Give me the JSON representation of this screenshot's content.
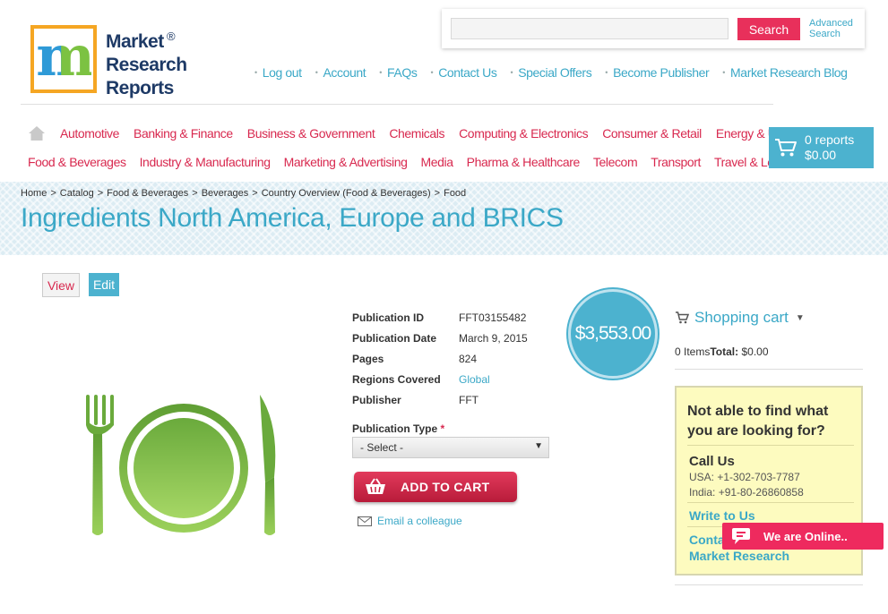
{
  "brand": {
    "logo_letter": "m",
    "name_lines": [
      "Market",
      "Research",
      "Reports"
    ],
    "registered": "®"
  },
  "search": {
    "placeholder": "",
    "button_label": "Search",
    "advanced_line1": "Advanced",
    "advanced_line2": "Search"
  },
  "top_nav": [
    "Log out",
    "Account",
    "FAQs",
    "Contact Us",
    "Special Offers",
    "Become Publisher",
    "Market Research Blog"
  ],
  "categories": {
    "row1": [
      "Automotive",
      "Banking & Finance",
      "Business & Government",
      "Chemicals",
      "Computing & Electronics",
      "Consumer & Retail",
      "Energy & Utilities"
    ],
    "row2": [
      "Food & Beverages",
      "Industry & Manufacturing",
      "Marketing & Advertising",
      "Media",
      "Pharma & Healthcare",
      "Telecom",
      "Transport",
      "Travel & Leisure"
    ]
  },
  "cart": {
    "count": "0 reports",
    "total": "$0.00"
  },
  "breadcrumb": [
    "Home",
    "Catalog",
    "Food & Beverages",
    "Beverages",
    "Country Overview (Food & Beverages)",
    "Food"
  ],
  "page_title": "Ingredients North America, Europe and BRICS",
  "tabs": {
    "view": "View",
    "edit": "Edit"
  },
  "details": [
    {
      "label": "Publication ID",
      "value": "FFT03155482"
    },
    {
      "label": "Publication Date",
      "value": "March 9, 2015"
    },
    {
      "label": "Pages",
      "value": "824"
    },
    {
      "label": "Regions Covered",
      "value": "Global"
    },
    {
      "label": "Publisher",
      "value": "FFT"
    }
  ],
  "price": "$3,553.00",
  "publication_type": {
    "label": "Publication Type",
    "required_mark": "*",
    "selected": "- Select -"
  },
  "add_to_cart_label": "ADD TO CART",
  "email_colleague_label": "Email a colleague",
  "shopping_cart": {
    "title": "Shopping cart",
    "items_text": "0 Items",
    "total_label": "Total:",
    "total_value": " $0.00"
  },
  "help": {
    "question_line1": "Not able to find what",
    "question_line2": "you are looking for?",
    "call_us": "Call Us",
    "usa": "USA: +1-302-703-7787",
    "india": "India: +91-80-26860858",
    "write_to_us": "Write to Us",
    "contact_line1": "Contact",
    "contact_line2": "Market Research"
  },
  "chat": {
    "label": "We are Online.."
  },
  "colors": {
    "accent_blue": "#4cb2cf",
    "link_blue": "#3ba8c7",
    "accent_red": "#d8294f",
    "logo_orange": "#f5a623",
    "plate_green": "#7cc242"
  }
}
